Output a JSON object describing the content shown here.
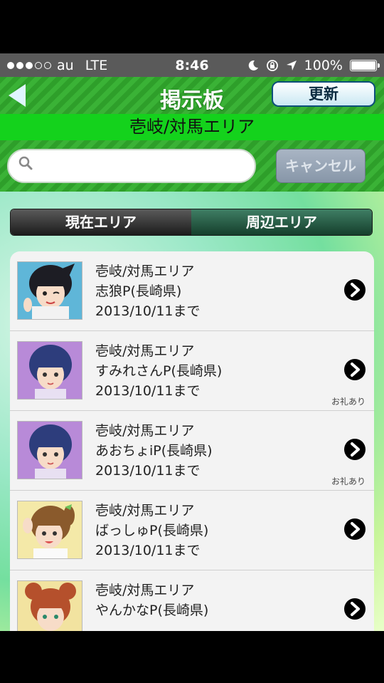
{
  "status": {
    "carrier": "au",
    "network": "LTE",
    "time": "8:46",
    "battery": "100%",
    "signal_bars_filled": 3,
    "signal_bars_total": 5,
    "battery_level": 1.0
  },
  "nav": {
    "title": "掲示板",
    "refresh_label": "更新",
    "back_icon": "back-arrow-icon"
  },
  "area_title": "壱岐/対馬エリア",
  "search": {
    "value": "",
    "placeholder": "",
    "cancel_label": "キャンセル"
  },
  "tabs": [
    {
      "label": "現在エリア",
      "active": true
    },
    {
      "label": "周辺エリア",
      "active": false
    }
  ],
  "colors": {
    "nav_green": "#34a830",
    "area_green": "#14d21c",
    "tab_active": "#2a2a2a",
    "tab_inactive": "#1f5a40"
  },
  "items": [
    {
      "area": "壱岐/対馬エリア",
      "name": "志狼P(長崎県)",
      "date": "2013/10/11まで",
      "badge": "",
      "avatar": "avatar-black-ponytail"
    },
    {
      "area": "壱岐/対馬エリア",
      "name": "すみれさんP(長崎県)",
      "date": "2013/10/11まで",
      "badge": "お礼あり",
      "avatar": "avatar-blue-short-hair"
    },
    {
      "area": "壱岐/対馬エリア",
      "name": "あおちょiP(長崎県)",
      "date": "2013/10/11まで",
      "badge": "お礼あり",
      "avatar": "avatar-blue-short-hair"
    },
    {
      "area": "壱岐/対馬エリア",
      "name": "ばっしゅP(長崎県)",
      "date": "2013/10/11まで",
      "badge": "",
      "avatar": "avatar-brown-twintail"
    },
    {
      "area": "壱岐/対馬エリア",
      "name": "やんかなP(長崎県)",
      "date": "",
      "badge": "",
      "avatar": "avatar-orange-buns"
    }
  ]
}
